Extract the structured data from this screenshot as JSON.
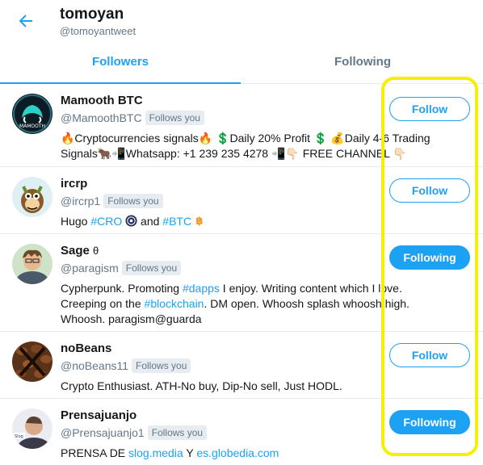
{
  "header": {
    "title": "tomoyan",
    "handle": "@tomoyantweet"
  },
  "tabs": [
    {
      "label": "Followers"
    },
    {
      "label": "Following"
    }
  ],
  "users": [
    {
      "name": "Mamooth BTC",
      "handle": "@MamoothBTC",
      "follows_you": "Follows you",
      "bio_line1": "🔥Cryptocurrencies signals🔥 💲Daily 20% Profit 💲 💰Daily 4-6 Trading",
      "bio_line2": "Signals🐂📲Whatsapp: +1 239 235 4278 📲👇🏻 FREE CHANNEL 👇🏻",
      "button": "Follow",
      "avatar_text": "MAMOOTH"
    },
    {
      "name": "ircrp",
      "handle": "@ircrp1",
      "follows_you": "Follows you",
      "bio_prefix": "Hugo ",
      "bio_tag1": "#CRO",
      "bio_mid": " and ",
      "bio_tag2": "#BTC",
      "button": "Follow"
    },
    {
      "name": "Sage",
      "name_suffix": "θ",
      "handle": "@paragism",
      "follows_you": "Follows you",
      "bio_a": "Cypherpunk. Promoting ",
      "bio_tag1": "#dapps",
      "bio_b": " I enjoy. Writing content which I love.",
      "bio_c": "Creeping on the ",
      "bio_tag2": "#blockchain",
      "bio_d": ". DM open. Whoosh splash whoosh high.",
      "bio_e": "Whoosh. paragism@guarda",
      "button": "Following"
    },
    {
      "name": "noBeans",
      "handle": "@noBeans11",
      "follows_you": "Follows you",
      "bio": "Crypto Enthusiast. ATH-No buy, Dip-No sell, Just HODL.",
      "button": "Follow"
    },
    {
      "name": "Prensajuanjo",
      "handle": "@Prensajuanjo1",
      "follows_you": "Follows you",
      "bio_a": "PRENSA DE ",
      "bio_link1": "slog.media",
      "bio_b": " Y ",
      "bio_link2": "es.globedia.com",
      "button": "Following",
      "avatar_text": "Slog"
    }
  ],
  "colors": {
    "accent": "#1da1f2",
    "highlight": "#f5f000",
    "muted": "#657786"
  }
}
